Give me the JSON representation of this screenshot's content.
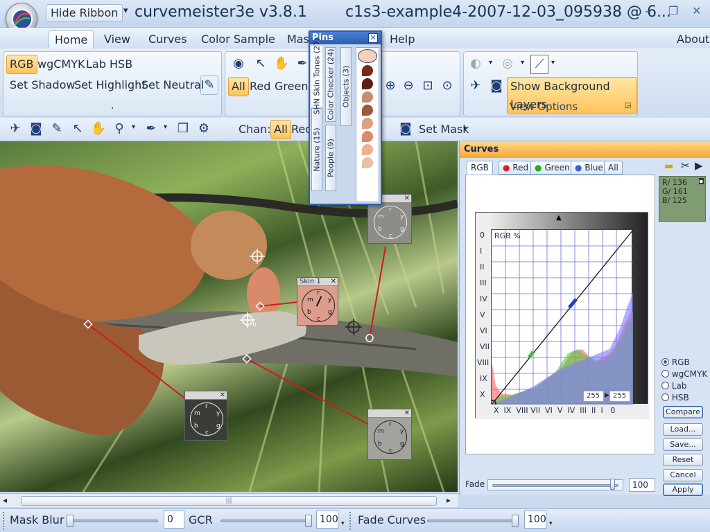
{
  "window": {
    "title": "curvemeister3e v3.8.1",
    "document": "c1s3-example4-2007-12-03_095938 @ 6...",
    "hide_ribbon": "Hide Ribbon",
    "min_glyph": "–",
    "max_glyph": "❐",
    "close_glyph": "✕"
  },
  "menu_tabs": [
    "Home",
    "View",
    "Curves",
    "Color Sample",
    "Mask",
    "Help"
  ],
  "about": "About",
  "ribbon": {
    "color_modes": [
      "RGB",
      "wgCMYK",
      "Lab",
      "HSB"
    ],
    "set_buttons": [
      "Set Shadow",
      "Set Highlight",
      "Set Neutral"
    ],
    "channels": [
      "All",
      "Red",
      "Green"
    ],
    "view_options": {
      "show_bg": "Show Background Layers",
      "label": "View Options"
    },
    "group_dot": "."
  },
  "toolbar": {
    "chan_label": "Chan:",
    "chan_all": "All",
    "chan_next": "Red",
    "set_mask": "Set Mask"
  },
  "pins": {
    "title": "Pins",
    "tabs": [
      "Nature (15)",
      "SHN Skin Tones (27)",
      "People (9)",
      "Color Checker (24)",
      "Objects (3)"
    ]
  },
  "dials": {
    "skin_label": "Skin 1",
    "letters": [
      "m",
      "r",
      "y",
      "g",
      "c",
      "b"
    ],
    "b_marker": "b"
  },
  "curves": {
    "title": "Curves",
    "tabs": [
      "RGB",
      "Red",
      "Green",
      "Blue",
      "All"
    ],
    "graph_label": "RGB %",
    "y_labels": [
      "0",
      "I",
      "II",
      "III",
      "IV",
      "V",
      "VI",
      "VII",
      "VIII",
      "IX",
      "X"
    ],
    "x_labels": [
      "X",
      "IX",
      "VIII",
      "VII",
      "VI",
      "V",
      "IV",
      "III",
      "II",
      "I",
      "0"
    ],
    "input_value": "255",
    "output_value": "255",
    "color_readout": [
      "R/ 136",
      "G/ 161",
      "B/ 125"
    ],
    "fade_label": "Fade",
    "fade_value": "100",
    "fade_level": 1.0,
    "modes": [
      "RGB",
      "wgCMYK",
      "Lab",
      "HSB"
    ],
    "selected_mode": "RGB",
    "buttons": [
      "Compare",
      "Load...",
      "Save...",
      "Reset",
      "Cancel",
      "Apply"
    ]
  },
  "status": {
    "mask_blur_label": "Mask Blur",
    "mask_blur_value": "0",
    "mask_blur_level": 0.0,
    "gcr_label": "GCR",
    "gcr_value": "100",
    "gcr_level": 1.0,
    "fade_curves_label": "Fade Curves",
    "fade_curves_value": "100",
    "fade_curves_level": 1.0
  },
  "scroll": {
    "grip": "|||"
  },
  "colors": {
    "accent_orange": "#f5a636",
    "selected_yellow": "#ffc35a",
    "pin_line": "#d11a1a",
    "curve_line": "#1a1a1a"
  }
}
